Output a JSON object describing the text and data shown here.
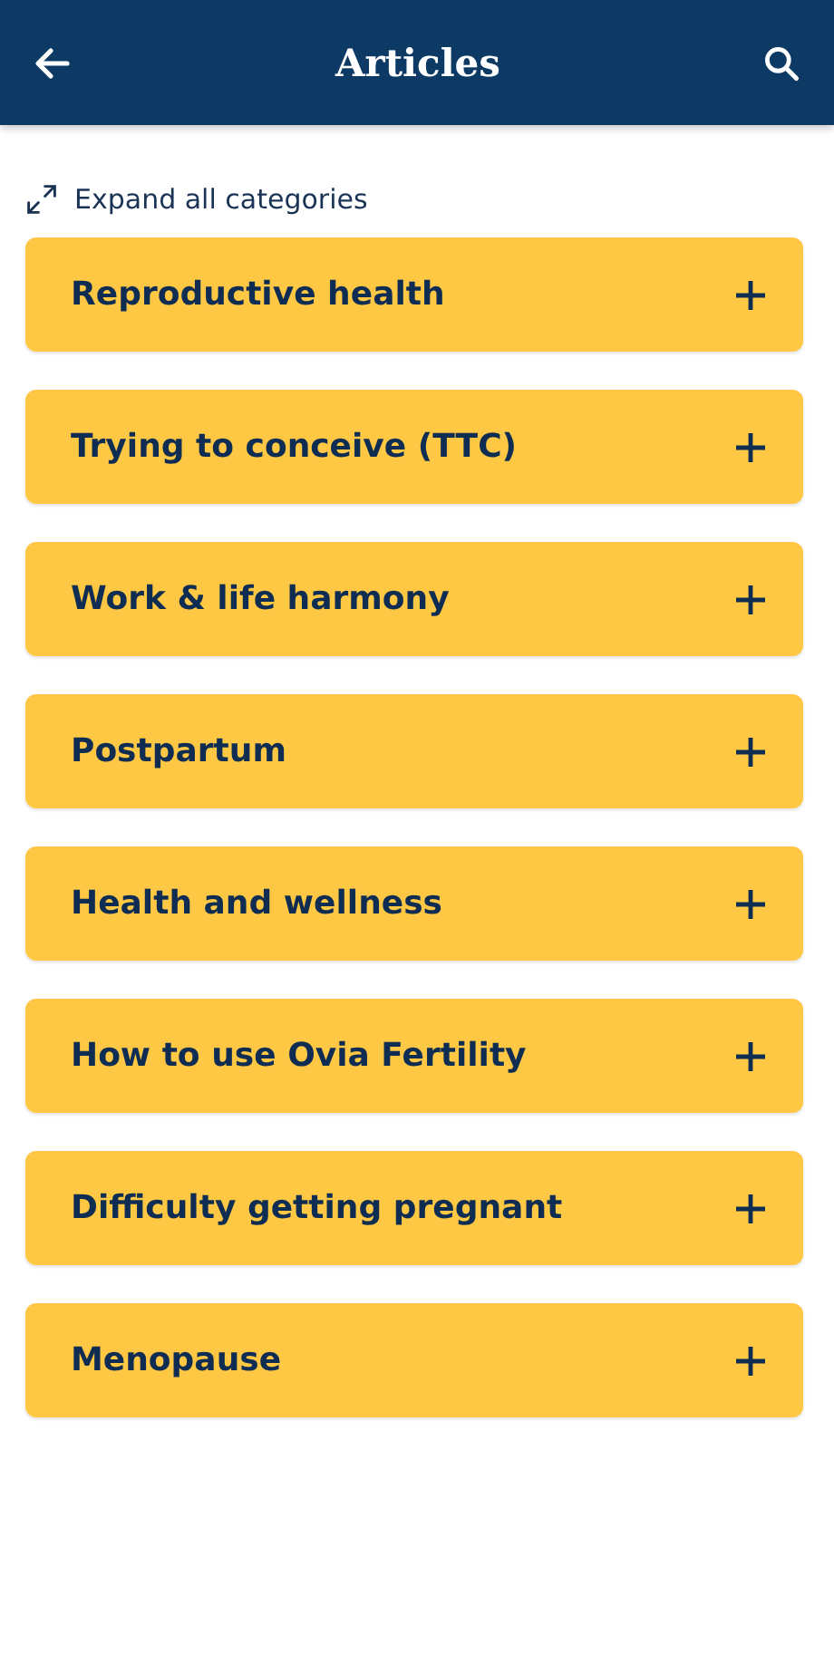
{
  "header": {
    "title": "Articles"
  },
  "expand_all": {
    "label": "Expand all categories"
  },
  "categories": [
    {
      "label": "Reproductive health",
      "expanded": false
    },
    {
      "label": "Trying to conceive (TTC)",
      "expanded": false
    },
    {
      "label": "Work & life harmony",
      "expanded": false
    },
    {
      "label": "Postpartum",
      "expanded": false
    },
    {
      "label": "Health and wellness",
      "expanded": false
    },
    {
      "label": "How to use Ovia Fertility",
      "expanded": false
    },
    {
      "label": "Difficulty getting pregnant",
      "expanded": false
    },
    {
      "label": "Menopause",
      "expanded": false
    }
  ]
}
